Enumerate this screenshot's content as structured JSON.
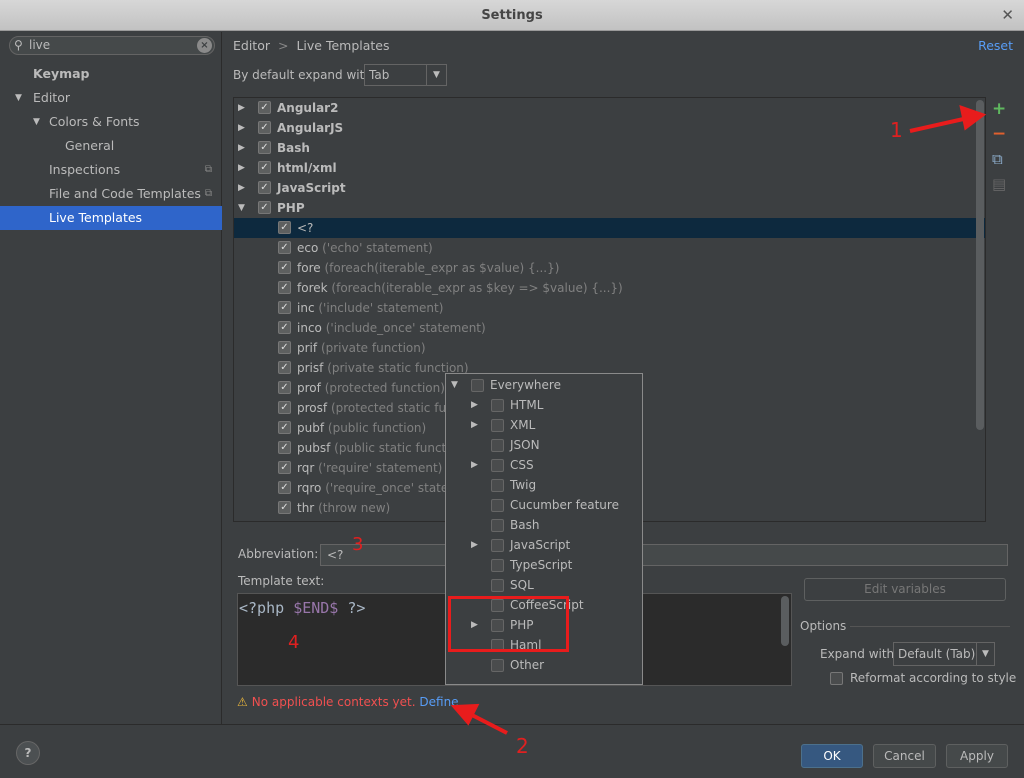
{
  "window": {
    "title": "Settings",
    "close_icon": "close-icon"
  },
  "search": {
    "value": "live"
  },
  "sidebar": {
    "items": [
      {
        "label": "Keymap"
      },
      {
        "label": "Editor"
      },
      {
        "label": "Colors & Fonts"
      },
      {
        "label": "General"
      },
      {
        "label": "Inspections"
      },
      {
        "label": "File and Code Templates"
      },
      {
        "label": "Live Templates",
        "selected": true
      }
    ]
  },
  "header": {
    "breadcrumb_editor": "Editor",
    "breadcrumb_sep": ">",
    "breadcrumb_page": "Live Templates",
    "reset": "Reset"
  },
  "expand": {
    "label": "By default expand with",
    "value": "Tab"
  },
  "tree": {
    "groups": [
      {
        "name": "Angular2"
      },
      {
        "name": "AngularJS"
      },
      {
        "name": "Bash"
      },
      {
        "name": "html/xml"
      },
      {
        "name": "JavaScript"
      },
      {
        "name": "PHP"
      }
    ],
    "php_items": [
      {
        "abbr": "<?",
        "desc": ""
      },
      {
        "abbr": "eco",
        "desc": "('echo' statement)"
      },
      {
        "abbr": "fore",
        "desc": "(foreach(iterable_expr as $value) {...})"
      },
      {
        "abbr": "forek",
        "desc": "(foreach(iterable_expr as $key => $value) {...})"
      },
      {
        "abbr": "inc",
        "desc": "('include' statement)"
      },
      {
        "abbr": "inco",
        "desc": "('include_once' statement)"
      },
      {
        "abbr": "prif",
        "desc": "(private function)"
      },
      {
        "abbr": "prisf",
        "desc": "(private static function)"
      },
      {
        "abbr": "prof",
        "desc": "(protected function)"
      },
      {
        "abbr": "prosf",
        "desc": "(protected static func"
      },
      {
        "abbr": "pubf",
        "desc": "(public function)"
      },
      {
        "abbr": "pubsf",
        "desc": "(public static function"
      },
      {
        "abbr": "rqr",
        "desc": "('require' statement)"
      },
      {
        "abbr": "rqro",
        "desc": "('require_once' statem"
      },
      {
        "abbr": "thr",
        "desc": "(throw new)"
      }
    ]
  },
  "toolbar": {
    "add": "+",
    "remove": "−"
  },
  "abbreviation": {
    "label": "Abbreviation:",
    "value": "<?"
  },
  "template": {
    "label": "Template text:",
    "code_pre": "<?php ",
    "code_var": "$END$",
    "code_post": " ?>"
  },
  "edit_variables": "Edit variables",
  "options": {
    "label": "Options",
    "expand_with_label": "Expand with",
    "expand_with_value": "Default (Tab)",
    "reformat_label": "Reformat according to style"
  },
  "warning": {
    "text": "No applicable contexts yet.",
    "define": "Define"
  },
  "footer": {
    "help": "?",
    "ok": "OK",
    "cancel": "Cancel",
    "apply": "Apply"
  },
  "context_popup": {
    "items": [
      {
        "label": "Everywhere",
        "expanded": true
      },
      {
        "label": "HTML",
        "arrow": true
      },
      {
        "label": "XML",
        "arrow": true
      },
      {
        "label": "JSON"
      },
      {
        "label": "CSS",
        "arrow": true
      },
      {
        "label": "Twig"
      },
      {
        "label": "Cucumber feature"
      },
      {
        "label": "Bash"
      },
      {
        "label": "JavaScript",
        "arrow": true
      },
      {
        "label": "TypeScript"
      },
      {
        "label": "SQL"
      },
      {
        "label": "CoffeeScript"
      },
      {
        "label": "PHP",
        "arrow": true
      },
      {
        "label": "Haml"
      },
      {
        "label": "Other"
      }
    ]
  },
  "annotations": {
    "n1": "1",
    "n2": "2",
    "n3": "3",
    "n4": "4"
  },
  "colors": {
    "accent_red": "#e81c1c",
    "selection": "#2f65ca",
    "link": "#589df6"
  }
}
